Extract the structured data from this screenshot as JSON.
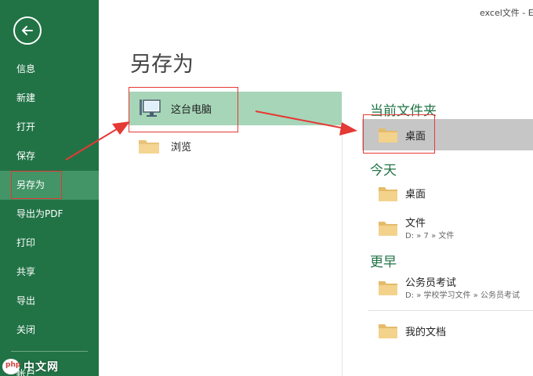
{
  "window": {
    "title": "excel文件 - E"
  },
  "sidebar": {
    "items": [
      {
        "label": "信息"
      },
      {
        "label": "新建"
      },
      {
        "label": "打开"
      },
      {
        "label": "保存"
      },
      {
        "label": "另存为"
      },
      {
        "label": "导出为PDF"
      },
      {
        "label": "打印"
      },
      {
        "label": "共享"
      },
      {
        "label": "导出"
      },
      {
        "label": "关闭"
      },
      {
        "label": "帐户"
      }
    ],
    "active_index": 4
  },
  "main": {
    "title": "另存为",
    "locations": [
      {
        "label": "这台电脑",
        "icon": "computer-icon",
        "selected": true
      },
      {
        "label": "浏览",
        "icon": "folder-icon",
        "selected": false
      }
    ],
    "current_folder": {
      "title": "当前文件夹",
      "items": [
        {
          "name": "桌面"
        }
      ]
    },
    "today": {
      "title": "今天",
      "items": [
        {
          "name": "桌面",
          "path": ""
        },
        {
          "name": "文件",
          "path": "D: » 7 » 文件"
        }
      ]
    },
    "earlier": {
      "title": "更早",
      "items": [
        {
          "name": "公务员考试",
          "path": "D: » 学校学习文件 » 公务员考试"
        },
        {
          "name": "我的文档",
          "path": ""
        }
      ]
    }
  },
  "watermark": {
    "logo": "php",
    "text": "中文网"
  },
  "colors": {
    "accent": "#217346",
    "sidebar_active": "#439467",
    "selected_row": "#a6d5b8",
    "annotation": "#e53935"
  }
}
